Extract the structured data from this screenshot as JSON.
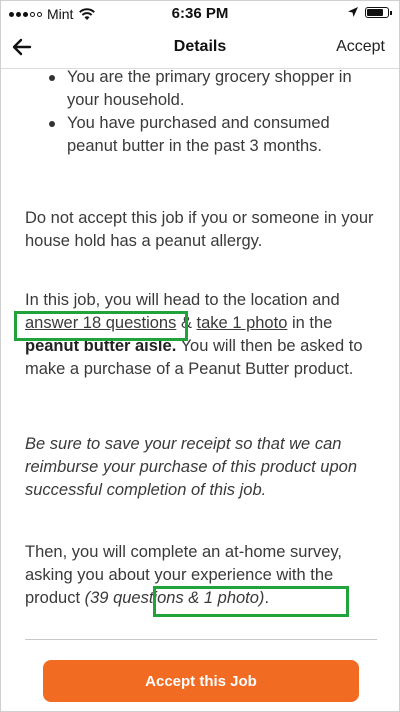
{
  "status_bar": {
    "carrier": "Mint",
    "time": "6:36 PM"
  },
  "nav": {
    "title": "Details",
    "accept_label": "Accept"
  },
  "requirements": [
    "You are the primary grocery shopper in your household.",
    "You have purchased and consumed peanut butter in the past 3 months."
  ],
  "allergy_notice": "Do not accept this job if you or someone in your house hold has a peanut allergy.",
  "job_description": {
    "intro": "In this job, you will head to the location and",
    "questions_link": "answer 18 questions",
    "connector": " & ",
    "photo_link": "take 1 photo",
    "in_the": " in the",
    "aisle": "peanut butter aisle.",
    "rest": " You will then be asked to make a purchase of a Peanut Butter product."
  },
  "receipt_note": "Be sure to save your receipt so that we can reimburse your purchase of this product upon successful completion of this job.",
  "survey": {
    "text": "Then, you will complete an at-home survey, asking you about your experience with the product",
    "detail": "(39 questions & 1 photo)",
    "end": "."
  },
  "cta": {
    "label": "Accept this Job"
  },
  "colors": {
    "accent": "#f26b22",
    "highlight": "#1fa33a"
  },
  "icons": [
    "signal-icon",
    "wifi-icon",
    "location-arrow-icon",
    "battery-icon",
    "back-arrow-icon"
  ]
}
